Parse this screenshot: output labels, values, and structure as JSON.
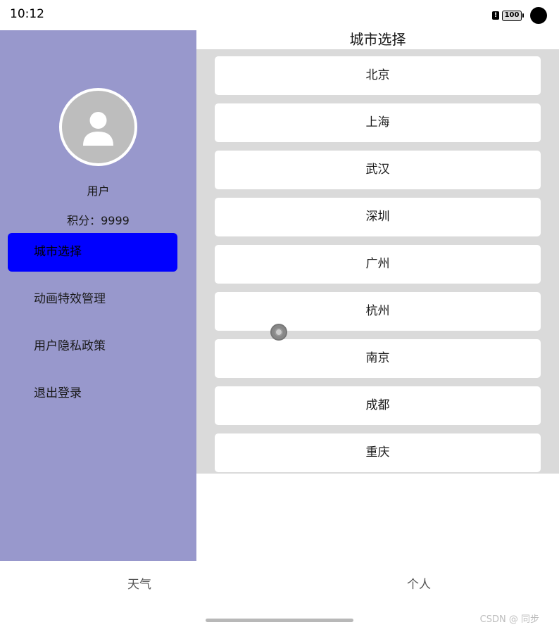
{
  "status_bar": {
    "time": "10:12",
    "battery": "100"
  },
  "sidebar": {
    "user_name": "用户",
    "points": "积分：9999",
    "menu": [
      {
        "label": "城市选择",
        "active": true
      },
      {
        "label": "动画特效管理",
        "active": false
      },
      {
        "label": "用户隐私政策",
        "active": false
      },
      {
        "label": "退出登录",
        "active": false
      }
    ]
  },
  "main": {
    "title": "城市选择",
    "cities": [
      "北京",
      "上海",
      "武汉",
      "深圳",
      "广州",
      "杭州",
      "南京",
      "成都",
      "重庆"
    ]
  },
  "tabs": [
    "天气",
    "个人"
  ],
  "watermark": "CSDN @ 同步",
  "colors": {
    "sidebar_bg": "#9898cc",
    "active_item": "#0000ff",
    "list_bg": "#dadada"
  }
}
